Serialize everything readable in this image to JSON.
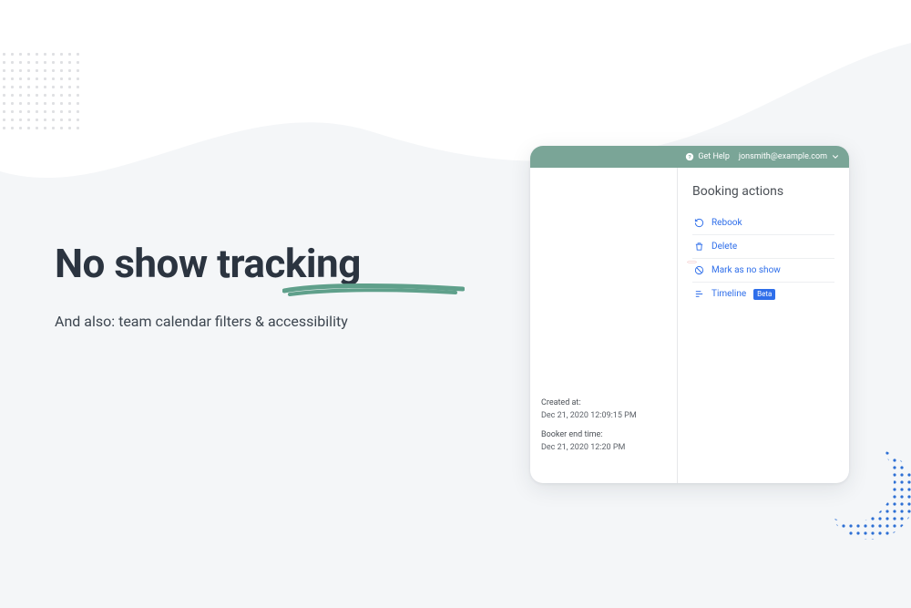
{
  "hero": {
    "title": "No show tracking",
    "subtitle": "And also: team calendar filters & accessibility"
  },
  "colors": {
    "page_bg": "#f4f6f8",
    "heading": "#2b3440",
    "swoosh": "#5fa08b",
    "topbar": "#7aa597",
    "link": "#2e6eea",
    "highlight": "#d83a3a",
    "dots_blue": "#2d6fd4"
  },
  "app": {
    "topbar": {
      "help_label": "Get Help",
      "user_email": "jonsmith@example.com"
    },
    "panel_title": "Booking actions",
    "actions": [
      {
        "key": "rebook",
        "label": "Rebook"
      },
      {
        "key": "delete",
        "label": "Delete"
      },
      {
        "key": "no_show",
        "label": "Mark as no show"
      },
      {
        "key": "timeline",
        "label": "Timeline",
        "badge": "Beta"
      }
    ],
    "meta": {
      "created_label": "Created at:",
      "created_value": "Dec 21, 2020 12:09:15 PM",
      "end_label": "Booker end time:",
      "end_value": "Dec 21, 2020 12:20 PM"
    }
  }
}
